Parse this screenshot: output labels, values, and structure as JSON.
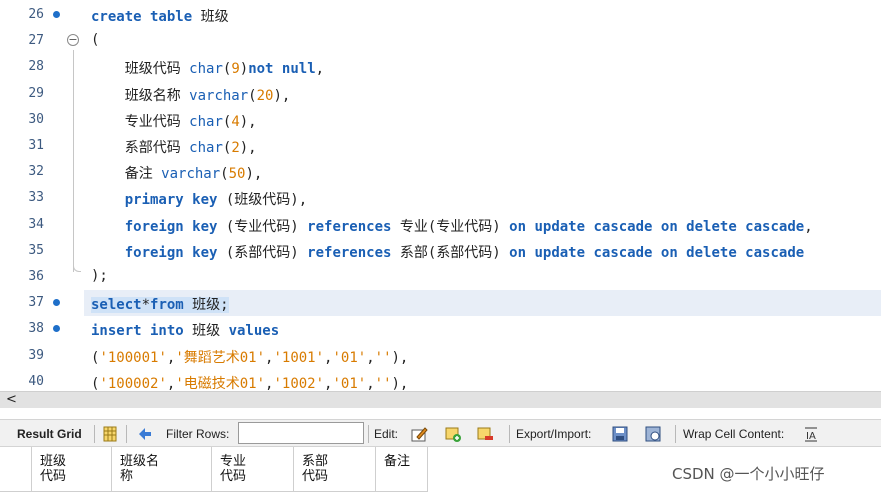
{
  "editor": {
    "lines": [
      {
        "num": "26",
        "marker": true,
        "segments": [
          {
            "t": "create table ",
            "c": "kw"
          },
          {
            "t": "班级",
            "c": ""
          }
        ]
      },
      {
        "num": "27",
        "fold": true,
        "segments": [
          {
            "t": "(",
            "c": ""
          }
        ]
      },
      {
        "num": "28",
        "segments": [
          {
            "t": "    班级代码 ",
            "c": ""
          },
          {
            "t": "char",
            "c": "ty"
          },
          {
            "t": "(",
            "c": ""
          },
          {
            "t": "9",
            "c": "num"
          },
          {
            "t": ")",
            "c": ""
          },
          {
            "t": "not null",
            "c": "kw"
          },
          {
            "t": ",",
            "c": ""
          }
        ]
      },
      {
        "num": "29",
        "segments": [
          {
            "t": "    班级名称 ",
            "c": ""
          },
          {
            "t": "varchar",
            "c": "ty"
          },
          {
            "t": "(",
            "c": ""
          },
          {
            "t": "20",
            "c": "num"
          },
          {
            "t": "),",
            "c": ""
          }
        ]
      },
      {
        "num": "30",
        "segments": [
          {
            "t": "    专业代码 ",
            "c": ""
          },
          {
            "t": "char",
            "c": "ty"
          },
          {
            "t": "(",
            "c": ""
          },
          {
            "t": "4",
            "c": "num"
          },
          {
            "t": "),",
            "c": ""
          }
        ]
      },
      {
        "num": "31",
        "segments": [
          {
            "t": "    系部代码 ",
            "c": ""
          },
          {
            "t": "char",
            "c": "ty"
          },
          {
            "t": "(",
            "c": ""
          },
          {
            "t": "2",
            "c": "num"
          },
          {
            "t": "),",
            "c": ""
          }
        ]
      },
      {
        "num": "32",
        "segments": [
          {
            "t": "    备注 ",
            "c": ""
          },
          {
            "t": "varchar",
            "c": "ty"
          },
          {
            "t": "(",
            "c": ""
          },
          {
            "t": "50",
            "c": "num"
          },
          {
            "t": "),",
            "c": ""
          }
        ]
      },
      {
        "num": "33",
        "segments": [
          {
            "t": "    ",
            "c": ""
          },
          {
            "t": "primary key",
            "c": "kw"
          },
          {
            "t": " (班级代码),",
            "c": ""
          }
        ]
      },
      {
        "num": "34",
        "segments": [
          {
            "t": "    ",
            "c": ""
          },
          {
            "t": "foreign key",
            "c": "kw"
          },
          {
            "t": " (专业代码) ",
            "c": ""
          },
          {
            "t": "references",
            "c": "kw"
          },
          {
            "t": " 专业(专业代码) ",
            "c": ""
          },
          {
            "t": "on update cascade on delete cascade",
            "c": "kw"
          },
          {
            "t": ",",
            "c": ""
          }
        ]
      },
      {
        "num": "35",
        "segments": [
          {
            "t": "    ",
            "c": ""
          },
          {
            "t": "foreign key",
            "c": "kw"
          },
          {
            "t": " (系部代码) ",
            "c": ""
          },
          {
            "t": "references",
            "c": "kw"
          },
          {
            "t": " 系部(系部代码) ",
            "c": ""
          },
          {
            "t": "on update cascade on delete cascade",
            "c": "kw"
          }
        ]
      },
      {
        "num": "36",
        "segments": [
          {
            "t": ");",
            "c": ""
          }
        ]
      },
      {
        "num": "37",
        "marker": true,
        "current": true,
        "segments": [
          {
            "t": "select",
            "c": "kw sel"
          },
          {
            "t": "*",
            "c": "sel"
          },
          {
            "t": "from",
            "c": "kw sel"
          },
          {
            "t": " 班级;",
            "c": "sel"
          }
        ]
      },
      {
        "num": "38",
        "marker": true,
        "segments": [
          {
            "t": "insert into",
            "c": "kw"
          },
          {
            "t": " 班级 ",
            "c": ""
          },
          {
            "t": "values",
            "c": "kw"
          }
        ]
      },
      {
        "num": "39",
        "segments": [
          {
            "t": "(",
            "c": ""
          },
          {
            "t": "'100001'",
            "c": "str"
          },
          {
            "t": ",",
            "c": ""
          },
          {
            "t": "'舞蹈艺术01'",
            "c": "str"
          },
          {
            "t": ",",
            "c": ""
          },
          {
            "t": "'1001'",
            "c": "str"
          },
          {
            "t": ",",
            "c": ""
          },
          {
            "t": "'01'",
            "c": "str"
          },
          {
            "t": ",",
            "c": ""
          },
          {
            "t": "''",
            "c": "str"
          },
          {
            "t": "),",
            "c": ""
          }
        ]
      },
      {
        "num": "40",
        "segments": [
          {
            "t": "(",
            "c": ""
          },
          {
            "t": "'100002'",
            "c": "str"
          },
          {
            "t": ",",
            "c": ""
          },
          {
            "t": "'电磁技术01'",
            "c": "str"
          },
          {
            "t": ",",
            "c": ""
          },
          {
            "t": "'1002'",
            "c": "str"
          },
          {
            "t": ",",
            "c": ""
          },
          {
            "t": "'01'",
            "c": "str"
          },
          {
            "t": ",",
            "c": ""
          },
          {
            "t": "''",
            "c": "str"
          },
          {
            "t": "),",
            "c": ""
          }
        ]
      }
    ]
  },
  "scrollbar": {
    "left_arrow": "<"
  },
  "toolbar": {
    "result_grid": "Result Grid",
    "filter_rows": "Filter Rows:",
    "filter_value": "",
    "edit": "Edit:",
    "export_import": "Export/Import:",
    "wrap_cell": "Wrap Cell Content:",
    "icons": [
      "grid-view-icon",
      "refresh-icon",
      "edit-row-icon",
      "add-row-icon",
      "delete-row-icon",
      "export-icon",
      "import-icon",
      "wrap-cell-icon"
    ],
    "accent": "#1e6fc9"
  },
  "grid": {
    "columns": [
      "班级\n代码",
      "班级名\n称",
      "专业\n代码",
      "系部\n代码",
      "备注"
    ]
  },
  "watermark": "CSDN @一个小小旺仔"
}
